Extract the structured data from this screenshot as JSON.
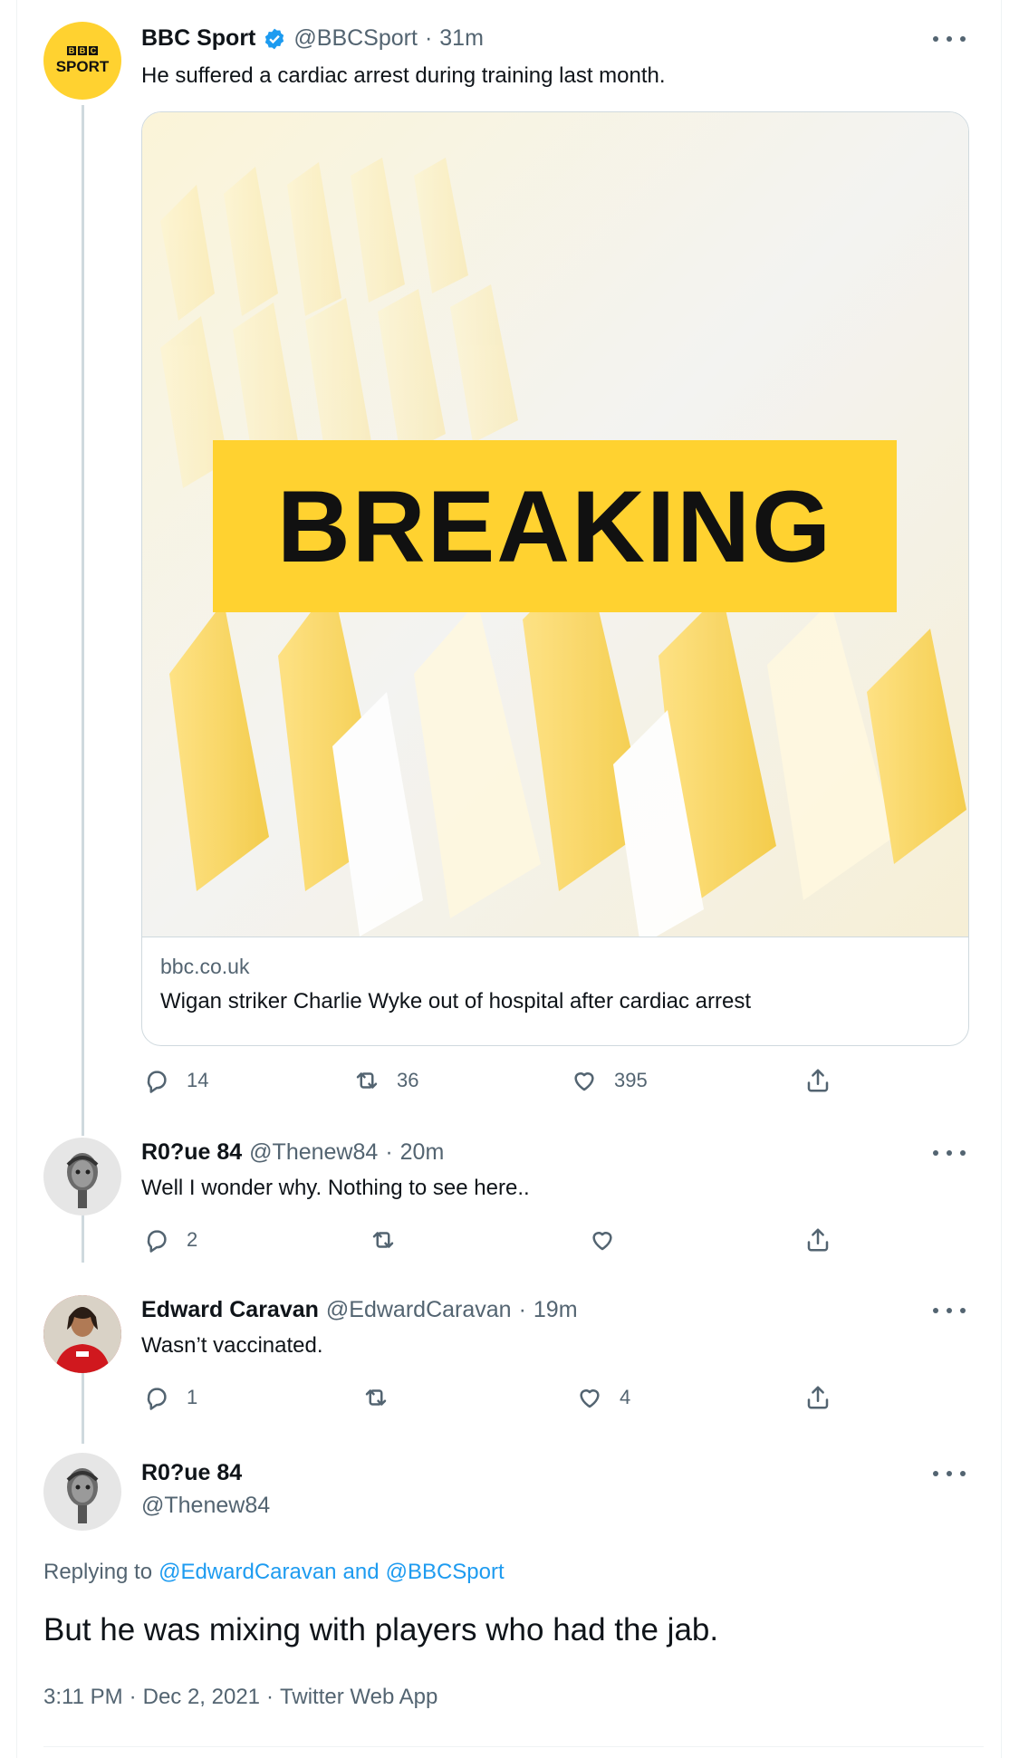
{
  "tweet1": {
    "author_name": "BBC Sport",
    "handle": "@BBCSport",
    "time": "31m",
    "avatar_line1": "BBC",
    "avatar_line2": "SPORT",
    "text": "He suffered a cardiac arrest during training last month.",
    "card": {
      "banner_text": "BREAKING",
      "domain": "bbc.co.uk",
      "title": "Wigan striker Charlie Wyke out of hospital after cardiac arrest"
    },
    "replies": "14",
    "retweets": "36",
    "likes": "395"
  },
  "tweet2": {
    "author_name": "R0?ue 84",
    "handle": "@Thenew84",
    "time": "20m",
    "text": "Well I wonder why.  Nothing to see here..",
    "replies": "2",
    "retweets": "",
    "likes": ""
  },
  "tweet3": {
    "author_name": "Edward Caravan",
    "handle": "@EdwardCaravan",
    "time": "19m",
    "text": "Wasn’t vaccinated.",
    "replies": "1",
    "retweets": "",
    "likes": "4"
  },
  "main_tweet": {
    "author_name": "R0?ue 84",
    "handle": "@Thenew84",
    "replying_prefix": "Replying to",
    "reply_to_1": "@EdwardCaravan",
    "reply_and": "and",
    "reply_to_2": "@BBCSport",
    "text": "But he was mixing with players who had the jab.",
    "time": "3:11 PM",
    "date": "Dec 2, 2021",
    "source": "Twitter Web App"
  },
  "separator": "·",
  "colors": {
    "accent": "#1d9bf0",
    "bbc_yellow": "#ffd230",
    "text_secondary": "#536471",
    "thread_line": "#cfd9de"
  },
  "icons": [
    "verified-badge-icon",
    "more-icon",
    "reply-icon",
    "retweet-icon",
    "like-icon",
    "share-icon"
  ]
}
